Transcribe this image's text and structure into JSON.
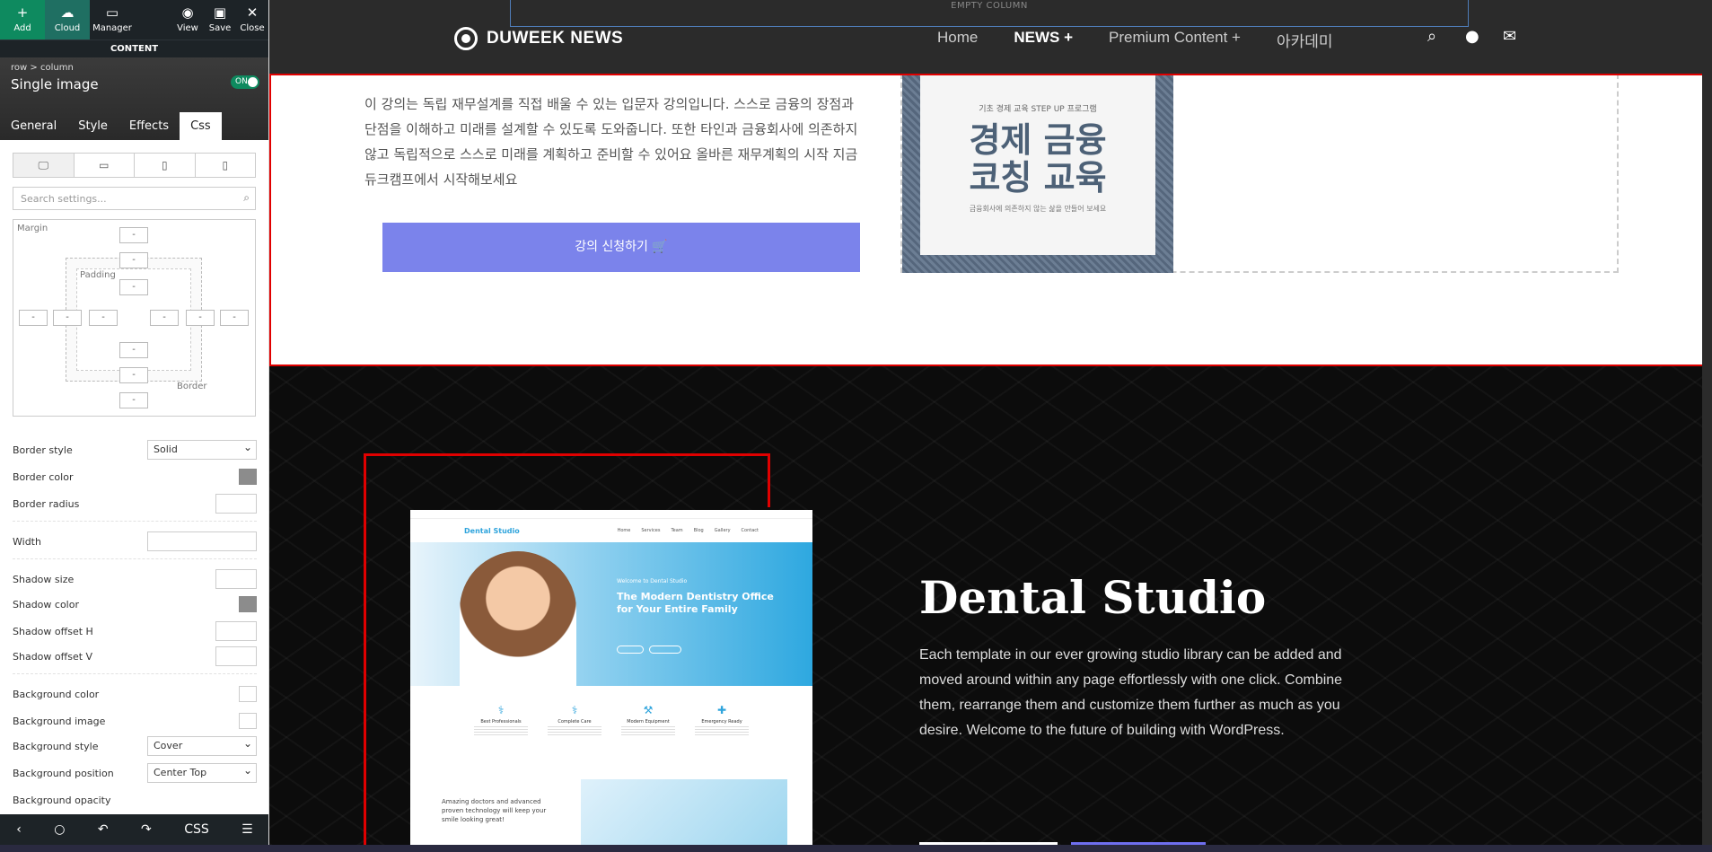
{
  "toolbar": {
    "add": "Add",
    "cloud": "Cloud",
    "manager": "Manager",
    "view": "View",
    "save": "Save",
    "close": "Close",
    "content": "CONTENT"
  },
  "element": {
    "crumb_row": "row",
    "crumb_sep": ">",
    "crumb_col": "column",
    "title": "Single image",
    "toggle": "ON"
  },
  "tabs": [
    "General",
    "Style",
    "Effects",
    "Css"
  ],
  "search_placeholder": "Search settings...",
  "boxmodel": {
    "margin": "Margin",
    "padding": "Padding",
    "border": "Border",
    "dash": "-"
  },
  "props": {
    "border_style": {
      "label": "Border style",
      "value": "Solid"
    },
    "border_color": "Border color",
    "border_radius": "Border radius",
    "width": "Width",
    "shadow_size": "Shadow size",
    "shadow_color": "Shadow color",
    "shadow_offset_h": "Shadow offset H",
    "shadow_offset_v": "Shadow offset V",
    "bg_color": "Background color",
    "bg_image": "Background image",
    "bg_style": {
      "label": "Background style",
      "value": "Cover"
    },
    "bg_position": {
      "label": "Background position",
      "value": "Center Top"
    },
    "bg_opacity": "Background opacity"
  },
  "bottom_bar": {
    "css": "CSS"
  },
  "site": {
    "empty_column": "EMPTY COLUMN",
    "logo": "DUWEEK NEWS",
    "nav": [
      "Home",
      "NEWS +",
      "Premium Content +",
      "아카데미"
    ]
  },
  "course": {
    "text": "이 강의는 독립 재무설계를 직접 배울 수 있는 입문자 강의입니다. 스스로 금융의 장점과 단점을 이해하고 미래를 설계할 수 있도록 도와줍니다. 또한 타인과 금융회사에 의존하지 않고 독립적으로 스스로 미래를 계획하고 준비할 수 있어요 올바른 재무계획의 시작 지금 듀크캠프에서 시작해보세요",
    "button": "강의 신청하기",
    "book_small": "기초 경제 교육 STEP UP 프로그램",
    "book_line1": "경제 금융",
    "book_line2": "코칭 교육",
    "book_sub": "금융회사에 의존하지 않는 삶을 만들어 보세요"
  },
  "dental": {
    "title": "Dental Studio",
    "desc": "Each template in our ever growing studio library can be added and moved around within any page effortlessly with one click. Combine them, rearrange them and customize them further as much as you desire. Welcome to the future of building with WordPress.",
    "shot_brand": "Dental Studio",
    "shot_links": [
      "Home",
      "Services",
      "Team",
      "Blog",
      "Gallery",
      "Contact"
    ],
    "shot_welcome": "Welcome to Dental Studio",
    "shot_title": "The Modern Dentistry Office for Your Entire Family",
    "features": [
      "Best Professionals",
      "Complete Care",
      "Modern Equipment",
      "Emergency Ready"
    ],
    "shot_bottom": "Amazing doctors and advanced proven technology will keep your smile looking great!"
  },
  "colors": {
    "accent_green": "#0e8a5f",
    "button_purple": "#7b83eb",
    "selection_red": "#e00000"
  }
}
